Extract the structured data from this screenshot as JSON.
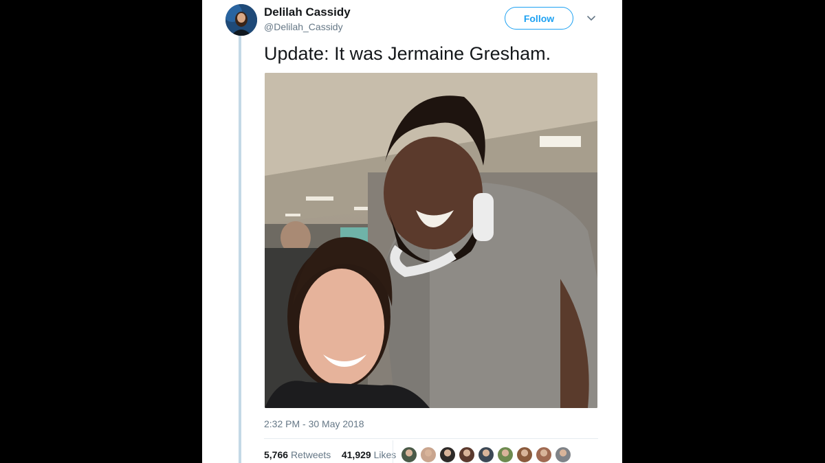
{
  "tweet": {
    "author": {
      "name": "Delilah Cassidy",
      "handle": "@Delilah_Cassidy"
    },
    "follow_label": "Follow",
    "caret_icon": "chevron-down-icon",
    "text": "Update: It was Jermaine Gresham.",
    "timestamp": "2:32 PM - 30 May 2018",
    "stats": {
      "retweets_count": "5,766",
      "retweets_label": "Retweets",
      "likes_count": "41,929",
      "likes_label": "Likes"
    },
    "liker_colors": [
      "#4a5a48",
      "#c9a58e",
      "#2d2a28",
      "#5b3a2e",
      "#3c4855",
      "#6d8a4f",
      "#8a5a3c",
      "#a06a52",
      "#7f8388"
    ]
  },
  "colors": {
    "accent": "#1da1f2",
    "text": "#14171a",
    "muted": "#657786",
    "thread": "#c4d9e6"
  }
}
